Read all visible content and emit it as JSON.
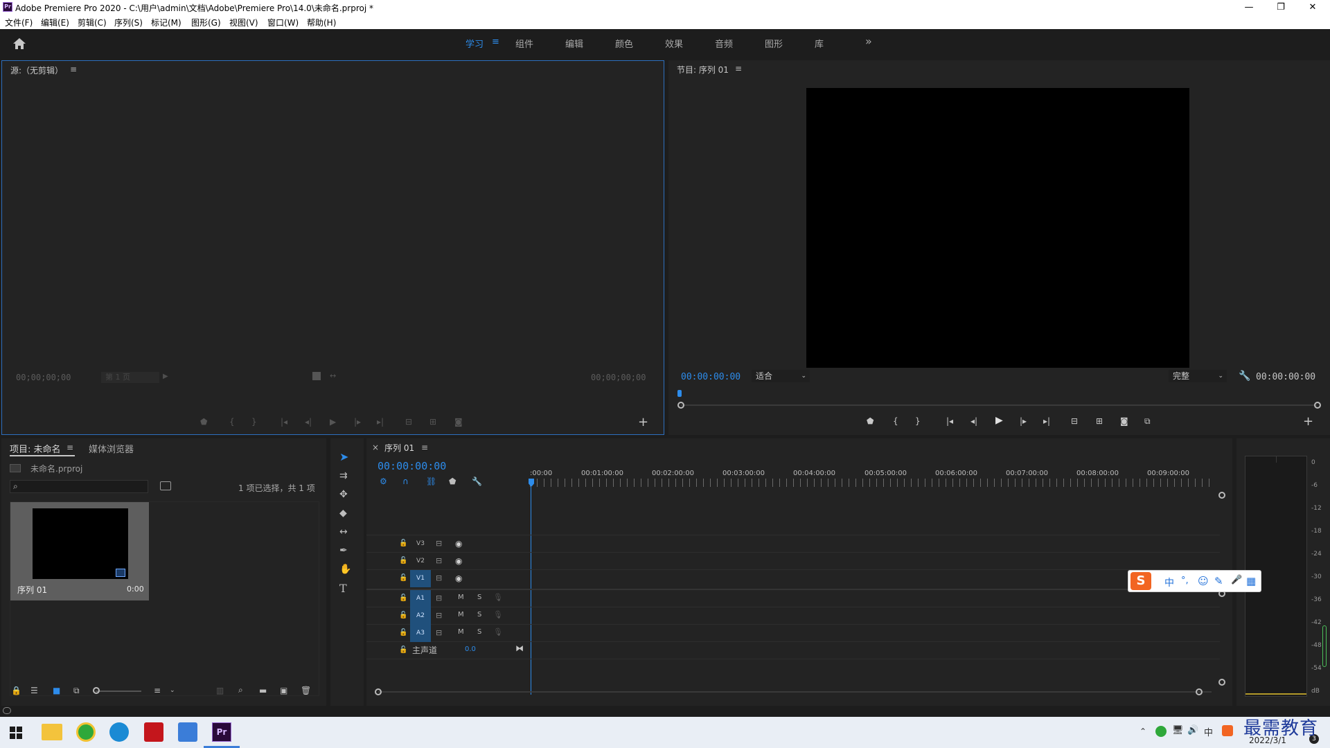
{
  "window": {
    "title": "Adobe Premiere Pro 2020 - C:\\用户\\admin\\文档\\Adobe\\Premiere Pro\\14.0\\未命名.prproj *",
    "app_badge": "Pr",
    "minimize": "—",
    "restore": "❐",
    "close": "✕"
  },
  "menu": [
    "文件(F)",
    "编辑(E)",
    "剪辑(C)",
    "序列(S)",
    "标记(M)",
    "图形(G)",
    "视图(V)",
    "窗口(W)",
    "帮助(H)"
  ],
  "workspaces": {
    "tabs": [
      "学习",
      "组件",
      "编辑",
      "颜色",
      "效果",
      "音频",
      "图形",
      "库"
    ],
    "active": "学习",
    "more": "»"
  },
  "source": {
    "title": "源:（无剪辑）",
    "menu_glyph": "≡",
    "tc_in": "00;00;00;00",
    "tc_out": "00;00;00;00",
    "page_select": "第 1 页",
    "add": "+"
  },
  "program": {
    "title": "节目: 序列 01",
    "menu_glyph": "≡",
    "tc_current": "00:00:00:00",
    "fit": "适合",
    "quality": "完整",
    "tc_duration": "00:00:00:00",
    "add": "+"
  },
  "project": {
    "tab_active": "项目: 未命名",
    "tab_menu": "≡",
    "tab_other": "媒体浏览器",
    "filename": "未命名.prproj",
    "selection": "1 项已选择，共 1 项",
    "item_name": "序列 01",
    "item_duration": "0:00"
  },
  "timeline": {
    "close": "×",
    "tab": "序列 01",
    "tab_menu": "≡",
    "timecode": "00:00:00:00",
    "ruler": [
      ":00:00",
      "00:01:00:00",
      "00:02:00:00",
      "00:03:00:00",
      "00:04:00:00",
      "00:05:00:00",
      "00:06:00:00",
      "00:07:00:00",
      "00:08:00:00",
      "00:09:00:00"
    ],
    "video_tracks": [
      "V3",
      "V2",
      "V1"
    ],
    "audio_tracks": [
      "A1",
      "A2",
      "A3"
    ],
    "mute": "M",
    "solo": "S",
    "master_label": "主声道",
    "master_value": "0.0"
  },
  "meter": {
    "scale": [
      "0",
      "-6",
      "-12",
      "-18",
      "-24",
      "-30",
      "-36",
      "-42",
      "-48",
      "-54",
      "dB"
    ]
  },
  "ime": {
    "logo": "S",
    "lang": "中",
    "punct": "°,",
    "emoji": "☺",
    "brush": "✎",
    "mic": "🎤",
    "grid": "▦"
  },
  "taskbar": {
    "date": "2022/3/1",
    "ime_lang": "中",
    "watermark": "最需教育",
    "badge": "3"
  },
  "colors": {
    "accent_blue": "#2d8ceb",
    "panel_bg": "#232323",
    "frame_bg": "#1d1d1d",
    "track_blue": "#20507c",
    "active_border": "#2d6fbf"
  }
}
